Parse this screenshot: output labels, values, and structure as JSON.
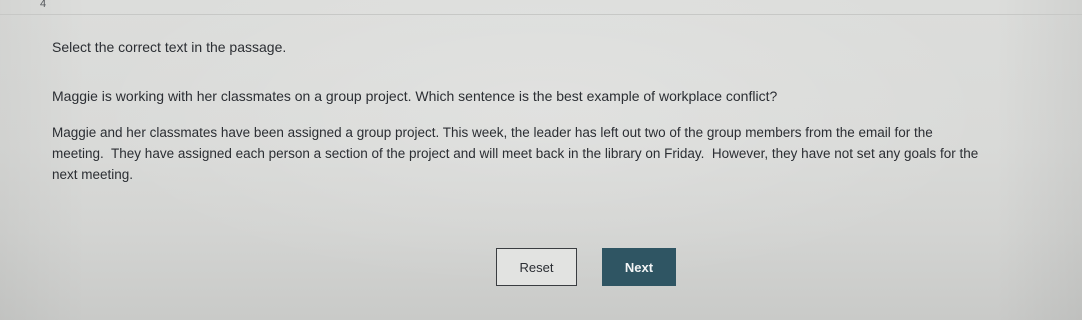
{
  "page": {
    "number": "4"
  },
  "prompt": {
    "instruction": "Select the correct text in the passage.",
    "question": "Maggie is working with her classmates on a group project. Which sentence is the best example of workplace conflict?"
  },
  "passage": {
    "sentences": [
      "Maggie and her classmates have been assigned a group project.",
      "This week, the leader has left out two of the group members from the email for the meeting.",
      "They have assigned each person a section of the project and will meet back in the library on Friday.",
      "However, they have not set any goals for the next meeting."
    ]
  },
  "actions": {
    "reset_label": "Reset",
    "next_label": "Next"
  },
  "colors": {
    "next_button": "#2f5563",
    "background": "#d9dad8",
    "text": "#2b2e33"
  }
}
